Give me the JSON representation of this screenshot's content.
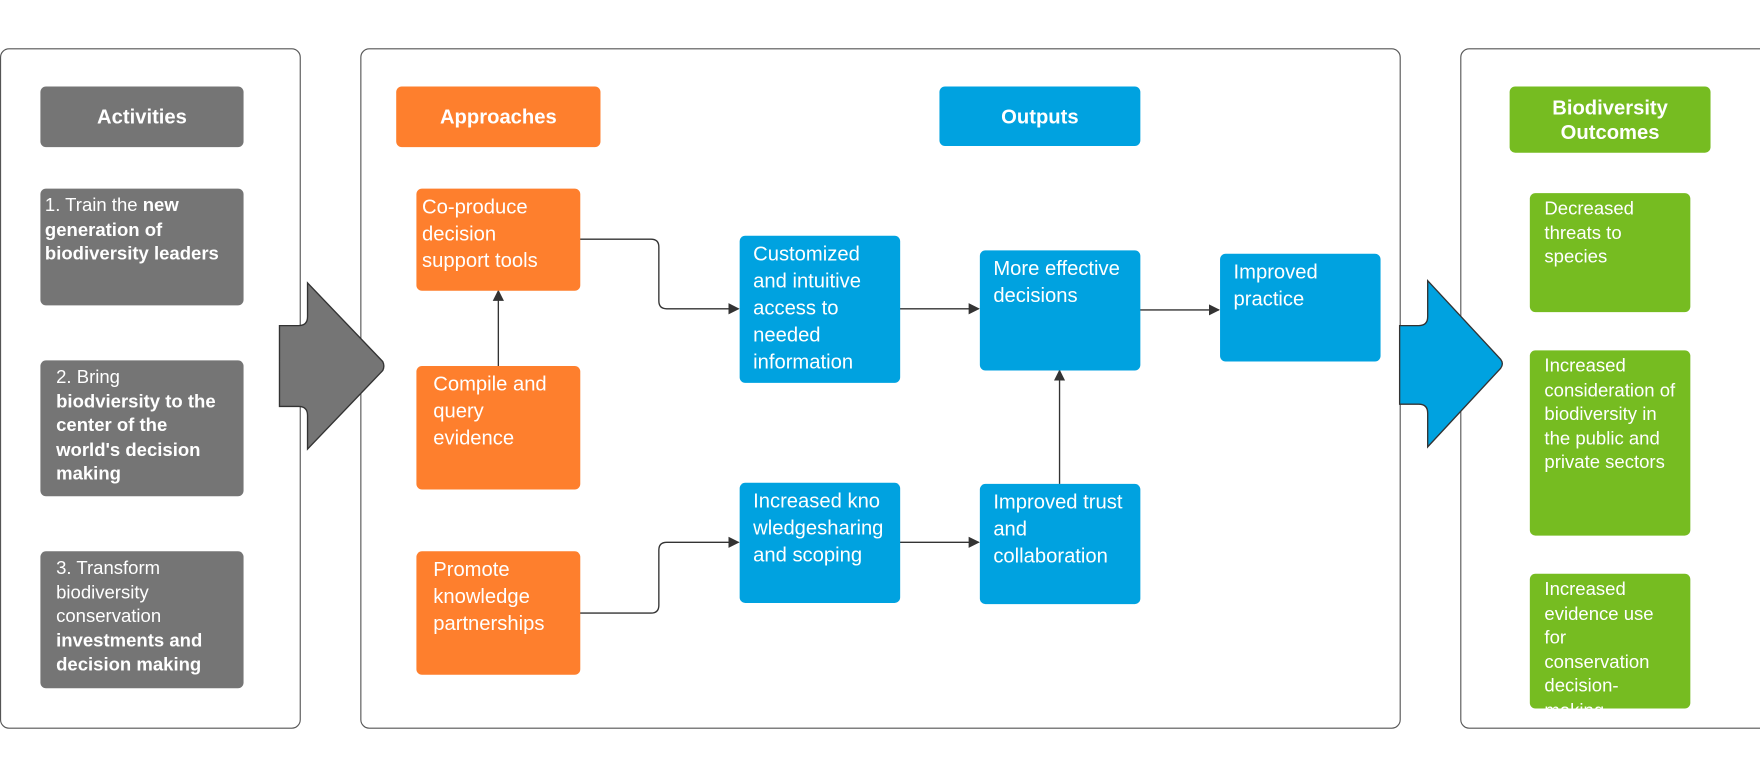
{
  "colors": {
    "activities": "#757575",
    "approaches": "#fe7f2d",
    "outputs": "#00a2e0",
    "outcomes": "#76bc21"
  },
  "headers": {
    "activities": "Activities",
    "approaches": "Approaches",
    "outputs": "Outputs",
    "outcomes": "Biodiversity Outcomes"
  },
  "activities": [
    {
      "plain": "1. Train the ",
      "bold": "new generation of biodiversity leaders",
      "after": ""
    },
    {
      "plain": "2. Bring ",
      "bold": "biodviersity to the center of the world's decision making",
      "after": ""
    },
    {
      "plain": "3. Transform biodiversity conservation ",
      "bold": "investments and decision making",
      "after": ""
    }
  ],
  "approaches": [
    "Co-produce decision support tools",
    "Compile and query evidence",
    "Promote knowledge partnerships"
  ],
  "outputs": {
    "access": "Customized and intuitive access to needed information",
    "decisions": "More effective decisions",
    "practice": "Improved practice",
    "knowledge": "Increased knowledgesharing and scoping",
    "trust": "Improved trust and collaboration"
  },
  "outcomes": [
    "Decreased threats to species",
    "Increased consideration of biodiversity in the public and private sectors",
    "Increased evidence use for conservation decision-making"
  ]
}
